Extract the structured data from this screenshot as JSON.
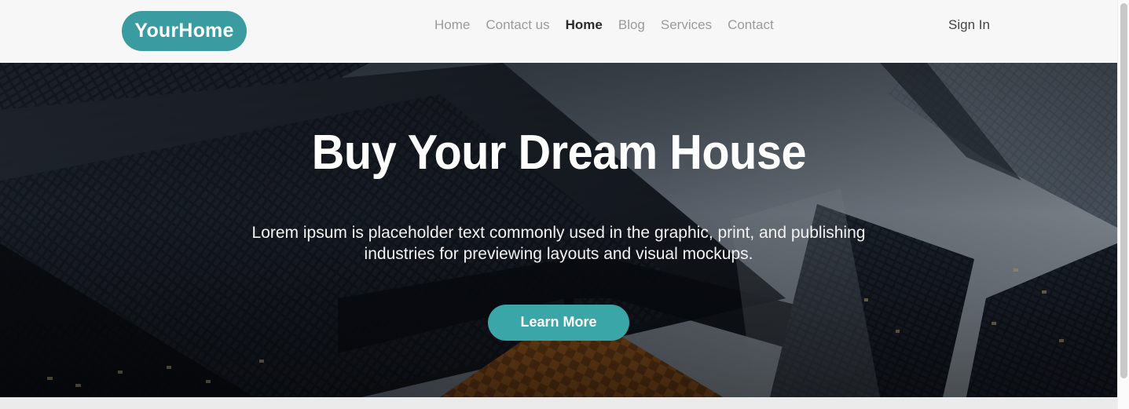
{
  "header": {
    "logo": "YourHome",
    "nav_items": [
      {
        "label": "Home",
        "active": false
      },
      {
        "label": "Contact us",
        "active": false
      },
      {
        "label": "Home",
        "active": true
      },
      {
        "label": "Blog",
        "active": false
      },
      {
        "label": "Services",
        "active": false
      },
      {
        "label": "Contact",
        "active": false
      }
    ],
    "sign_in": "Sign In"
  },
  "hero": {
    "title": "Buy Your Dream House",
    "subtitle": "Lorem ipsum is placeholder text commonly used in the graphic, print, and publishing industries for previewing layouts and visual mockups.",
    "cta_label": "Learn More",
    "background": "city-skyscrapers-photo"
  },
  "colors": {
    "accent_teal": "#3a9ba0",
    "cta_teal": "#3aa6a8",
    "header_bg": "#f7f7f7",
    "nav_muted": "#9b9b9b",
    "nav_active": "#2b2b2b",
    "hero_dark": "#10141b"
  },
  "scrollbar": {
    "thumb": "vertical-scroll-thumb"
  }
}
